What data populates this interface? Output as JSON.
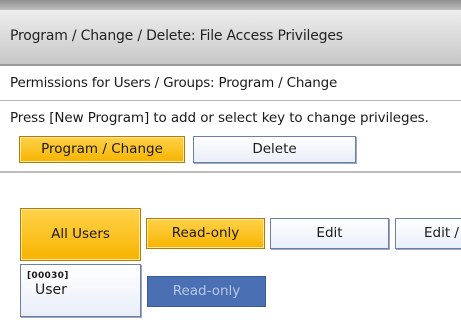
{
  "header": {
    "title": "Program / Change / Delete: File Access Privileges"
  },
  "subheader": {
    "title": "Permissions for Users / Groups: Program / Change"
  },
  "instruction": "Press [New Program] to add or select key to change privileges.",
  "mode_tabs": [
    {
      "label": "Program / Change",
      "selected": true
    },
    {
      "label": "Delete",
      "selected": false
    }
  ],
  "all_users_button": {
    "label": "All Users",
    "selected": true
  },
  "all_users_permissions": [
    {
      "label": "Read-only",
      "selected": true
    },
    {
      "label": "Edit",
      "selected": false
    },
    {
      "label": "Edit / D",
      "selected": false
    }
  ],
  "users": [
    {
      "code": "[00030]",
      "name": "User",
      "permission": "Read-only"
    }
  ],
  "colors": {
    "selected": "#f7b400",
    "unselected": "#ffffff",
    "permission_badge": "#4b6fb3"
  }
}
